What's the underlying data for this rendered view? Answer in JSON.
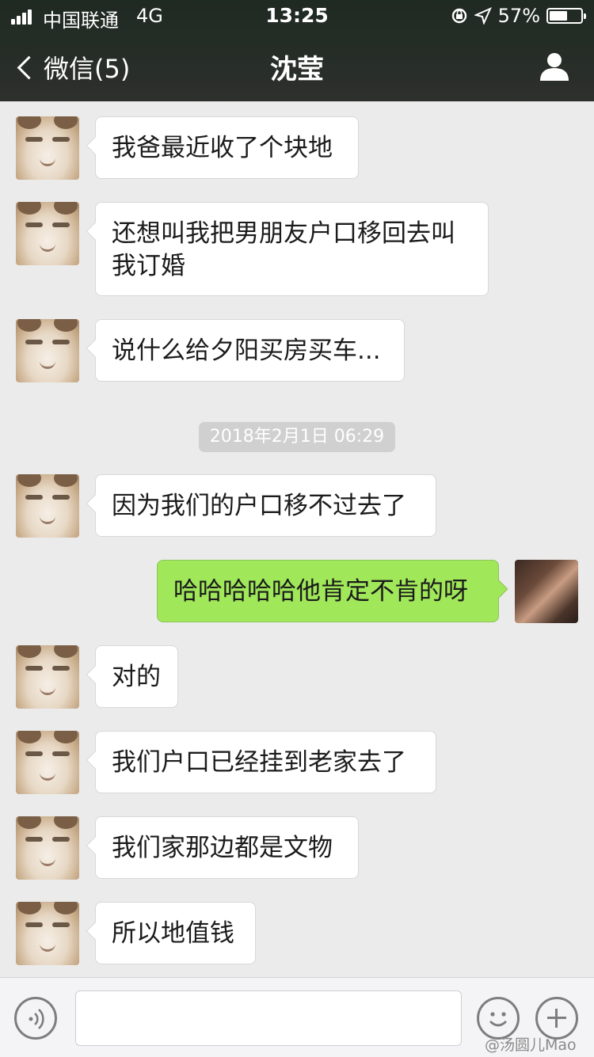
{
  "status_bar": {
    "carrier": "中国联通",
    "network": "4G",
    "time": "13:25",
    "battery_text": "57%",
    "battery_level": 0.57
  },
  "nav": {
    "back_label": "微信(5)",
    "title": "沈莹"
  },
  "messages": [
    {
      "side": "in",
      "text": "我爸最近收了个块地"
    },
    {
      "side": "in",
      "text": "还想叫我把男朋友户口移回去叫我订婚"
    },
    {
      "side": "in",
      "text": "说什么给夕阳买房买车..."
    },
    {
      "timestamp": "2018年2月1日 06:29"
    },
    {
      "side": "in",
      "text": "因为我们的户口移不过去了"
    },
    {
      "side": "out",
      "text": "哈哈哈哈哈他肯定不肯的呀"
    },
    {
      "side": "in",
      "text": "对的"
    },
    {
      "side": "in",
      "text": "我们户口已经挂到老家去了"
    },
    {
      "side": "in",
      "text": "我们家那边都是文物"
    },
    {
      "side": "in",
      "text": "所以地值钱"
    }
  ],
  "input_bar": {
    "icons": [
      "voice-icon",
      "emoji-icon",
      "plus-icon"
    ]
  },
  "watermark": "@汤圆儿Mao"
}
